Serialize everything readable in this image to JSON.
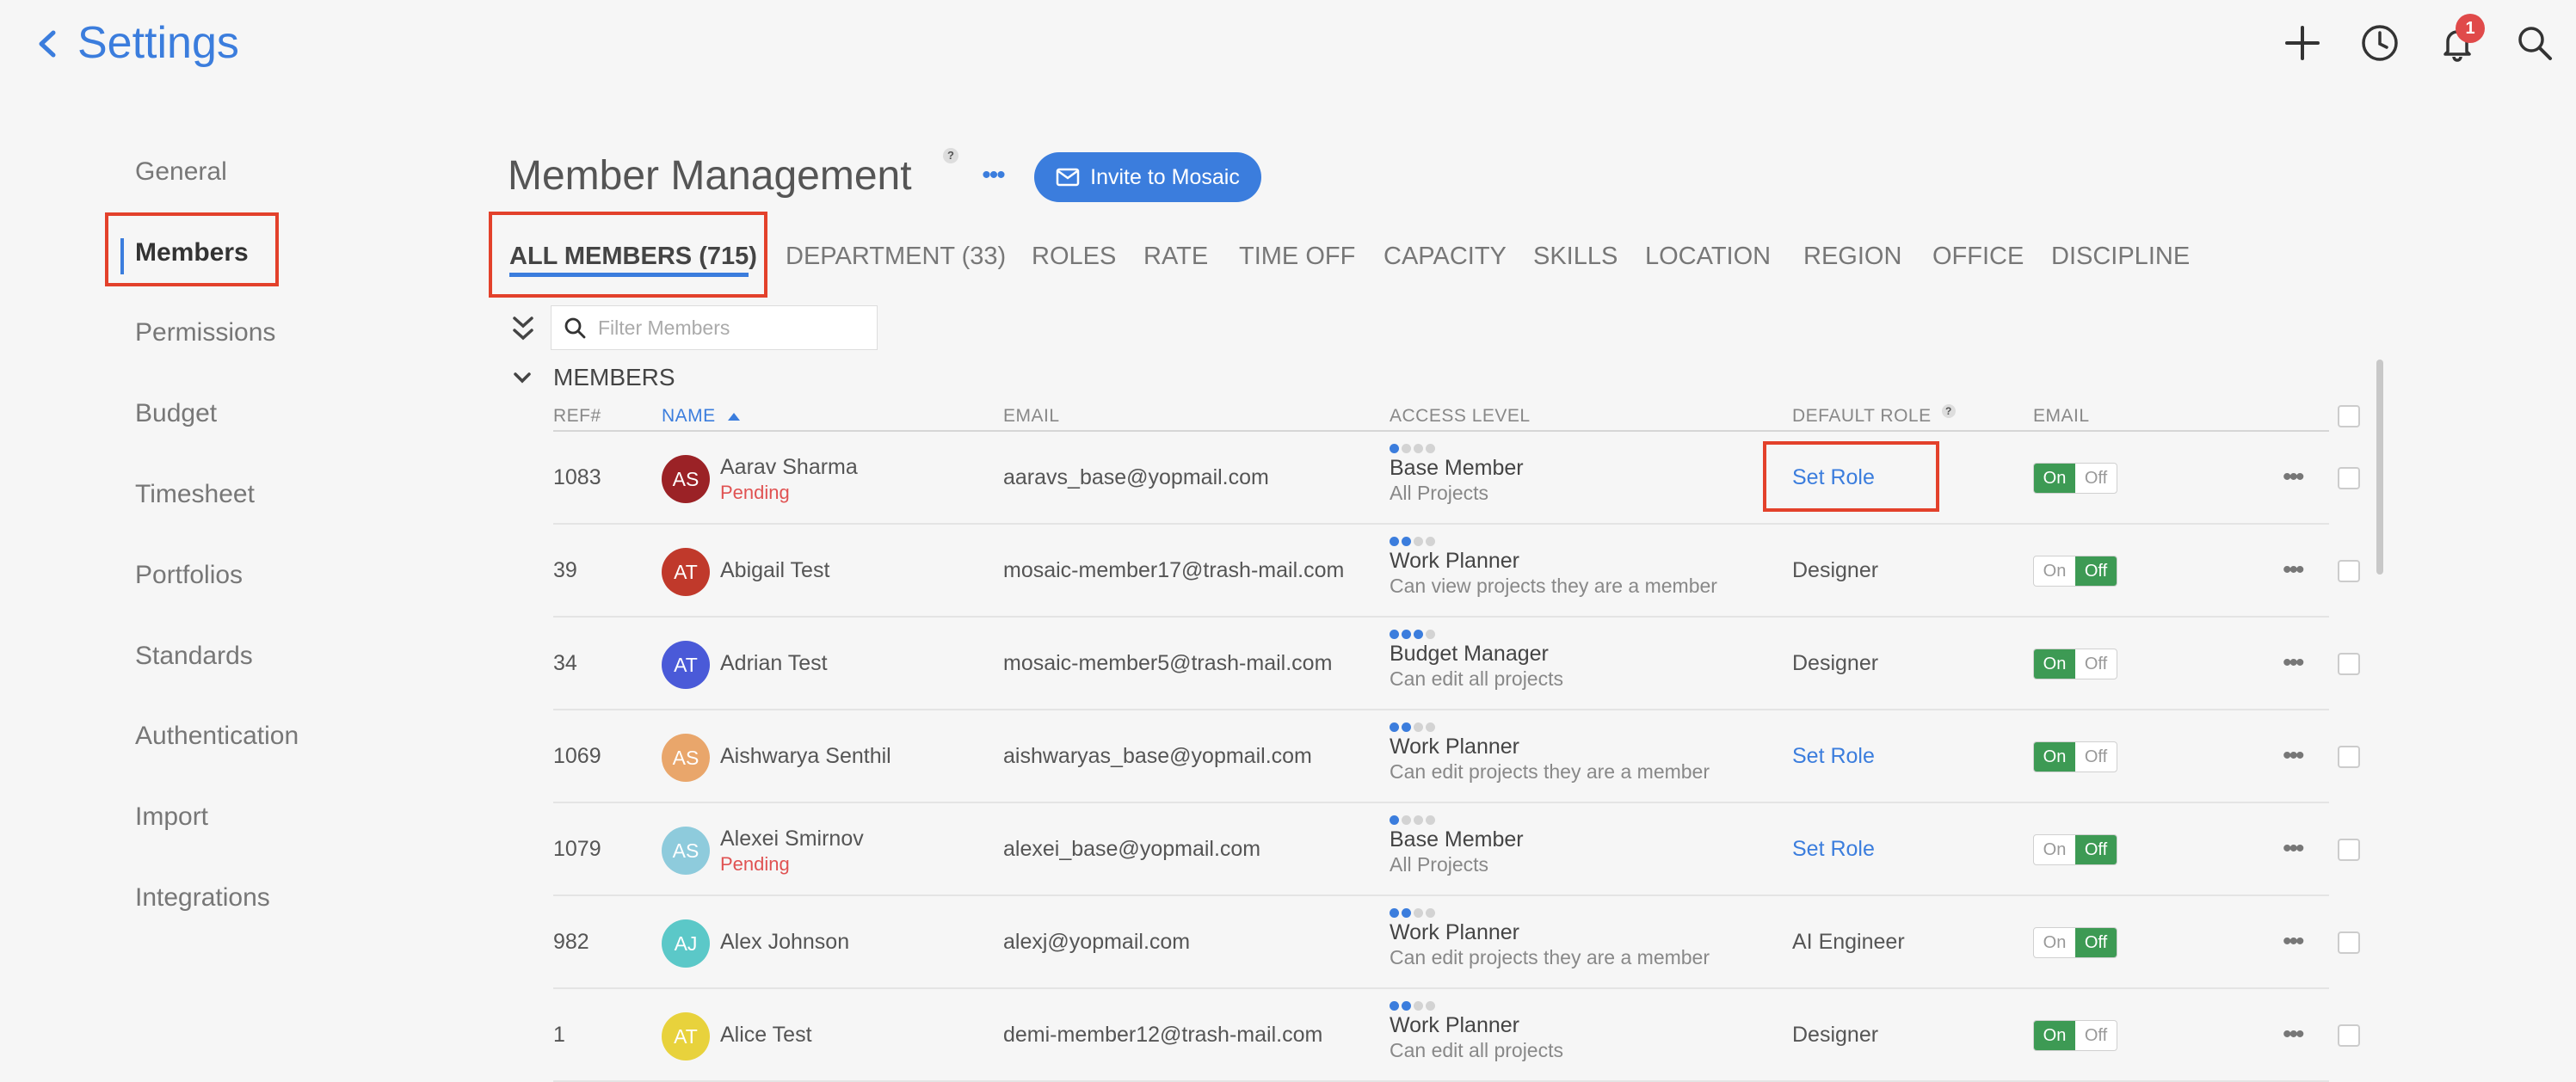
{
  "header": {
    "title": "Settings",
    "notification_count": "1"
  },
  "sidebar": {
    "items": [
      {
        "label": "General"
      },
      {
        "label": "Members"
      },
      {
        "label": "Permissions"
      },
      {
        "label": "Budget"
      },
      {
        "label": "Timesheet"
      },
      {
        "label": "Portfolios"
      },
      {
        "label": "Standards"
      },
      {
        "label": "Authentication"
      },
      {
        "label": "Import"
      },
      {
        "label": "Integrations"
      }
    ],
    "active": "Members"
  },
  "page": {
    "title": "Member Management",
    "help_mark": "?",
    "more_label": "•••",
    "invite_label": "Invite to Mosaic"
  },
  "tabs": [
    {
      "label": "ALL MEMBERS (715)"
    },
    {
      "label": "DEPARTMENT (33)"
    },
    {
      "label": "ROLES"
    },
    {
      "label": "RATE"
    },
    {
      "label": "TIME OFF"
    },
    {
      "label": "CAPACITY"
    },
    {
      "label": "SKILLS"
    },
    {
      "label": "LOCATION"
    },
    {
      "label": "REGION"
    },
    {
      "label": "OFFICE"
    },
    {
      "label": "DISCIPLINE"
    }
  ],
  "filter": {
    "placeholder": "Filter Members"
  },
  "section": {
    "title": "MEMBERS"
  },
  "table": {
    "columns": {
      "ref": "REF#",
      "name": "NAME",
      "email": "EMAIL",
      "access": "ACCESS LEVEL",
      "role": "DEFAULT ROLE",
      "email_toggle": "EMAIL"
    },
    "toggle_labels": {
      "on": "On",
      "off": "Off"
    },
    "row_more": "•••",
    "rows": [
      {
        "ref": "1083",
        "initials": "AS",
        "avatar_color": "#9b2226",
        "name": "Aarav Sharma",
        "status": "Pending",
        "email": "aaravs_base@yopmail.com",
        "access_level": 1,
        "access": "Base Member",
        "access_sub": "All Projects",
        "role": "Set Role",
        "role_is_link": true,
        "email_on": true
      },
      {
        "ref": "39",
        "initials": "AT",
        "avatar_color": "#c0392b",
        "name": "Abigail Test",
        "status": "",
        "email": "mosaic-member17@trash-mail.com",
        "access_level": 2,
        "access": "Work Planner",
        "access_sub": "Can view projects they are a member",
        "role": "Designer",
        "role_is_link": false,
        "email_on": false
      },
      {
        "ref": "34",
        "initials": "AT",
        "avatar_color": "#4a5ad8",
        "name": "Adrian Test",
        "status": "",
        "email": "mosaic-member5@trash-mail.com",
        "access_level": 3,
        "access": "Budget Manager",
        "access_sub": "Can edit all projects",
        "role": "Designer",
        "role_is_link": false,
        "email_on": true
      },
      {
        "ref": "1069",
        "initials": "AS",
        "avatar_color": "#e9a66b",
        "name": "Aishwarya Senthil",
        "status": "",
        "email": "aishwaryas_base@yopmail.com",
        "access_level": 2,
        "access": "Work Planner",
        "access_sub": "Can edit projects they are a member",
        "role": "Set Role",
        "role_is_link": true,
        "email_on": true
      },
      {
        "ref": "1079",
        "initials": "AS",
        "avatar_color": "#8ecbdc",
        "name": "Alexei Smirnov",
        "status": "Pending",
        "email": "alexei_base@yopmail.com",
        "access_level": 1,
        "access": "Base Member",
        "access_sub": "All Projects",
        "role": "Set Role",
        "role_is_link": true,
        "email_on": false
      },
      {
        "ref": "982",
        "initials": "AJ",
        "avatar_color": "#5bc8c8",
        "name": "Alex Johnson",
        "status": "",
        "email": "alexj@yopmail.com",
        "access_level": 2,
        "access": "Work Planner",
        "access_sub": "Can edit projects they are a member",
        "role": "AI Engineer",
        "role_is_link": false,
        "email_on": false
      },
      {
        "ref": "1",
        "initials": "AT",
        "avatar_color": "#e8d23c",
        "name": "Alice Test",
        "status": "",
        "email": "demi-member12@trash-mail.com",
        "access_level": 2,
        "access": "Work Planner",
        "access_sub": "Can edit all projects",
        "role": "Designer",
        "role_is_link": false,
        "email_on": true
      }
    ]
  }
}
